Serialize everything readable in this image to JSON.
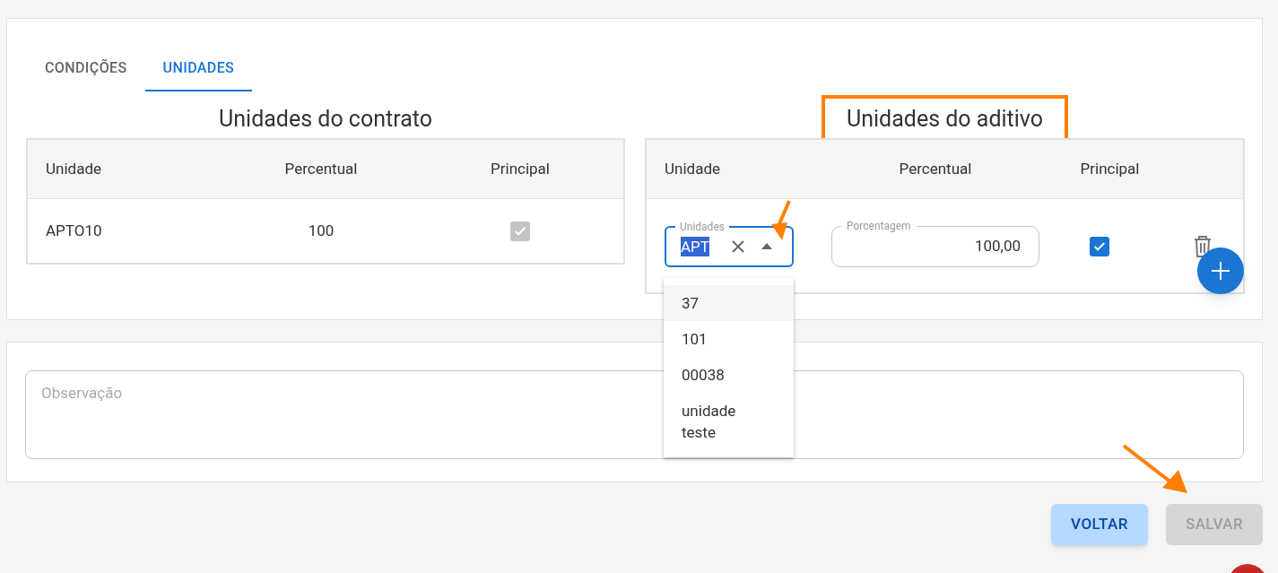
{
  "tabs": [
    {
      "label": "CONDIÇÕES",
      "selected": false
    },
    {
      "label": "UNIDADES",
      "selected": true
    }
  ],
  "contract_units": {
    "title": "Unidades do contrato",
    "columns": [
      "Unidade",
      "Percentual",
      "Principal"
    ],
    "rows": [
      {
        "unit": "APTO10",
        "percent": "100",
        "principal": true,
        "disabled": true
      }
    ]
  },
  "addendum_units": {
    "title": "Unidades do aditivo",
    "highlighted": true,
    "columns": [
      "Unidade",
      "Percentual",
      "Principal"
    ],
    "rows": [
      {
        "unit_label": "Unidades",
        "unit_value": "APT",
        "percent_label": "Porcentagem",
        "percent_value": "100,00",
        "principal": true
      }
    ],
    "dropdown": {
      "expanded": true,
      "options": [
        {
          "label": "37",
          "selected": true
        },
        {
          "label": "101",
          "selected": false
        },
        {
          "label": "00038",
          "selected": false
        },
        {
          "label": "unidade teste",
          "selected": false
        }
      ]
    }
  },
  "observation": {
    "placeholder": "Observação"
  },
  "buttons": [
    {
      "label": "VOLTAR",
      "disabled": false
    },
    {
      "label": "SALVAR",
      "disabled": true
    }
  ]
}
